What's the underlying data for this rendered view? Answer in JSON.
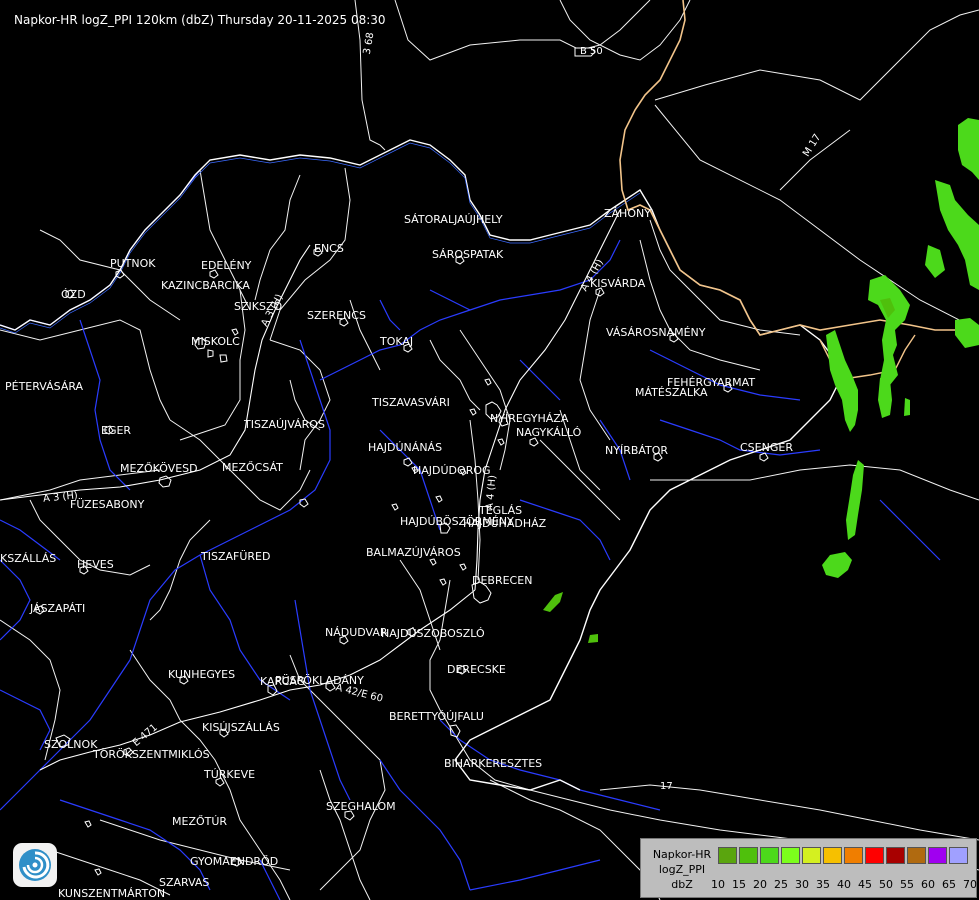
{
  "header": {
    "title": "Napkor-HR logZ_PPI 120km (dbZ) Thursday 20-11-2025 08:30"
  },
  "cities": [
    {
      "name": "SÁTORALJAÚJHELY"
    },
    {
      "name": "SÁROSPATAK"
    },
    {
      "name": "ZÁHONY"
    },
    {
      "name": "PUTNOK"
    },
    {
      "name": "EDELÉNY"
    },
    {
      "name": "ENCS"
    },
    {
      "name": "KAZINCBARCIKA"
    },
    {
      "name": "ÓZD"
    },
    {
      "name": "SZIKSZÓ"
    },
    {
      "name": "SZERENCS"
    },
    {
      "name": "KISVÁRDA"
    },
    {
      "name": "MISKOLC"
    },
    {
      "name": "TOKAJ"
    },
    {
      "name": "VÁSÁROSNAMÉNY"
    },
    {
      "name": "PÉTERVÁSÁRA"
    },
    {
      "name": "FEHÉRGYARMAT"
    },
    {
      "name": "MÁTÉSZALKA"
    },
    {
      "name": "TISZAVASVÁRI"
    },
    {
      "name": "NYÍREGYHÁZA"
    },
    {
      "name": "EGER"
    },
    {
      "name": "TISZAÚJVÁROS"
    },
    {
      "name": "NAGYKÁLLÓ"
    },
    {
      "name": "HAJDÚNÁNÁS"
    },
    {
      "name": "NYÍRBÁTOR"
    },
    {
      "name": "CSENGER"
    },
    {
      "name": "MEZŐKÖVESD"
    },
    {
      "name": "MEZŐCSÁT"
    },
    {
      "name": "HAJDÚDOROG"
    },
    {
      "name": "FÜZESABONY"
    },
    {
      "name": "TEGLÁS"
    },
    {
      "name": "HAJDÚBÖSZÖRMÉNY"
    },
    {
      "name": "HAJDÚHADHÁZ"
    },
    {
      "name": "BALMAZÚJVÁROS"
    },
    {
      "name": "TISZAFÜRED"
    },
    {
      "name": "KSZÁLLÁS"
    },
    {
      "name": "HEVES"
    },
    {
      "name": "DEBRECEN"
    },
    {
      "name": "JÁSZAPÁTI"
    },
    {
      "name": "NÁDUDVAR"
    },
    {
      "name": "HAJDÚSZOBOSZLÓ"
    },
    {
      "name": "DERECSKE"
    },
    {
      "name": "KUNHEGYES"
    },
    {
      "name": "PÜSPÖKLADÁNY"
    },
    {
      "name": "KARCAG"
    },
    {
      "name": "BERETTYÓÚJFALU"
    },
    {
      "name": "KISÚJSZÁLLÁS"
    },
    {
      "name": "SZOLNOK"
    },
    {
      "name": "TÖRÖKSZENTMIKLÓS"
    },
    {
      "name": "BIHARKERESZTES"
    },
    {
      "name": "TÚRKEVE"
    },
    {
      "name": "SZEGHALOM"
    },
    {
      "name": "MEZŐTÚR"
    },
    {
      "name": "GYOMAENDRŐD"
    },
    {
      "name": "SZARVAS"
    },
    {
      "name": "KUNSZENTMÁRTON"
    }
  ],
  "roads": [
    {
      "label": "3 68"
    },
    {
      "label": "B 50"
    },
    {
      "label": "M 17"
    },
    {
      "label": "A 3 (H)"
    },
    {
      "label": "A 4 (H)"
    },
    {
      "label": "A 3 (H)"
    },
    {
      "label": "A 4 (H)"
    },
    {
      "label": "A 42/E 60"
    },
    {
      "label": "E 471"
    },
    {
      "label": "17"
    }
  ],
  "legend": {
    "line1": "Napkor-HR",
    "line2": "logZ_PPI",
    "line3": "dbZ",
    "ticks": [
      "10",
      "15",
      "20",
      "25",
      "30",
      "35",
      "40",
      "45",
      "50",
      "55",
      "60",
      "65",
      "70"
    ],
    "colors": [
      "#5aa50e",
      "#4fc00c",
      "#4cd91b",
      "#7cff1c",
      "#d4f020",
      "#f6c000",
      "#f07e00",
      "#ff0000",
      "#a80000",
      "#b06a10",
      "#a000f0",
      "#a0a0ff"
    ]
  },
  "logo": {
    "icon": "swirl-icon"
  }
}
